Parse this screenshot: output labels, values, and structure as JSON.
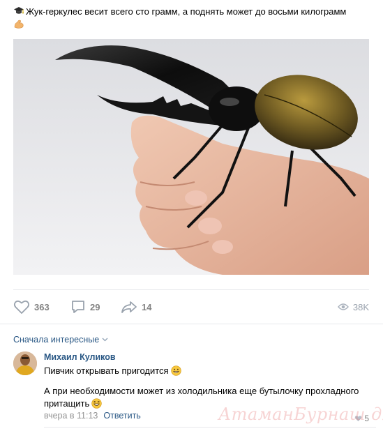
{
  "post": {
    "caption": "Жук-геркулес весит всего сто грамм, а поднять может до восьми килограмм",
    "caption_prefix_icon": "graduation-cap-icon",
    "caption_suffix_icon": "flexed-biceps-icon",
    "photo_alt": "Жук-геркулес на руке"
  },
  "actions": {
    "likes": "363",
    "comments": "29",
    "shares": "14",
    "views": "38K"
  },
  "comments_section": {
    "sort_label": "Сначала интересные"
  },
  "comment": {
    "author": "Михаил Куликов",
    "text1": "Пивчик открывать пригодится",
    "text2": "А при необходимости может из холодильника еще бутылочку прохладного притащить",
    "time": "вчера в 11:13",
    "reply_label": "Ответить",
    "likes": "5"
  },
  "watermark": "АтаманБурнаш для ЯП",
  "colors": {
    "link": "#2a5885",
    "muted": "#828282",
    "divider": "#e7e8ec"
  }
}
